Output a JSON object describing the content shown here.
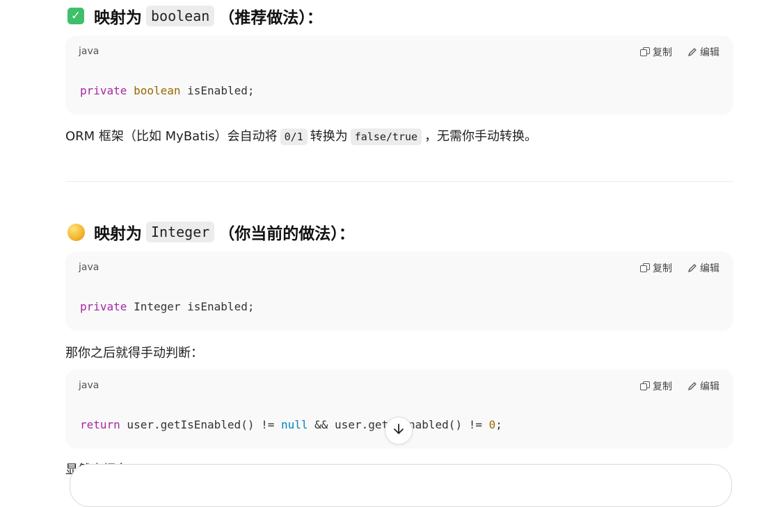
{
  "section1": {
    "icon": "check-mark-emoji-icon",
    "heading_pre": "映射为",
    "heading_code": "boolean",
    "heading_post": "（推荐做法）："
  },
  "block1": {
    "lang": "java",
    "copy_label": "复制",
    "edit_label": "编辑",
    "code": {
      "kw": "private",
      "type": "boolean",
      "rest": " isEnabled;"
    }
  },
  "para1": {
    "pre": "ORM 框架（比如 MyBatis）会自动将",
    "code1": "0/1",
    "mid": "转换为",
    "code2": "false/true",
    "post": "，无需你手动转换。"
  },
  "section2": {
    "icon": "yellow-circle-emoji-icon",
    "heading_pre": "映射为",
    "heading_code": "Integer",
    "heading_post": "（你当前的做法）："
  },
  "block2": {
    "lang": "java",
    "copy_label": "复制",
    "edit_label": "编辑",
    "code": {
      "kw": "private",
      "rest": " Integer isEnabled;"
    }
  },
  "para2": "那你之后就得手动判断：",
  "block3": {
    "lang": "java",
    "copy_label": "复制",
    "edit_label": "编辑",
    "code": {
      "kw": "return",
      "part1": " user.getIsEnabled() != ",
      "lit": "null",
      "part2": " && user.getIsEnabled() != ",
      "num": "0",
      "end": ";"
    }
  },
  "partial_text": "显然麻烦多了。"
}
